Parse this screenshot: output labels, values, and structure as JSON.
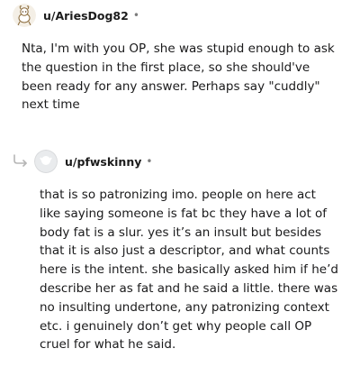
{
  "comments": [
    {
      "username": "u/AriesDog82",
      "separator": "•",
      "avatar_icon": "reddit-snoo-avatar-sketch",
      "body_lines": [
        "Nta, I'm with you OP, she was stupid enough to ask",
        "the question in the first place, so she should've",
        "been ready for any answer. Perhaps say \"cuddly\"",
        "next time"
      ]
    },
    {
      "username": "u/pfwskinny",
      "separator": "•",
      "avatar_icon": "default-avatar-placeholder",
      "reply_icon": "reply-arrow-icon",
      "body_lines": [
        "that is so patronizing imo. people on here act",
        "like saying someone is fat bc they have a lot of",
        "body fat is a slur. yes it’s an insult but besides",
        "that it is also just a descriptor, and what counts",
        "here is the intent. she basically asked him if he’d",
        "describe her as fat and he said a little. there was",
        "no insulting undertone, any patronizing context",
        "etc. i genuinely don’t get why people call OP",
        "cruel for what he said."
      ]
    }
  ],
  "colors": {
    "text": "#1a1a1b",
    "meta": "#7c7c7c",
    "avatar_placeholder": "#e9ebed"
  }
}
